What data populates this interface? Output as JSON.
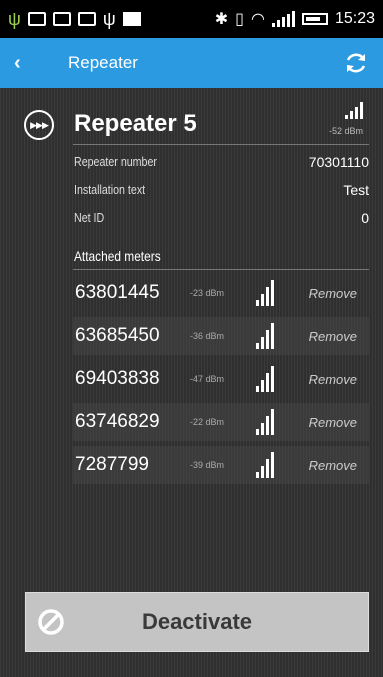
{
  "status_bar": {
    "time": "15:23",
    "icons": [
      "android-debug-icon",
      "notification-icon",
      "screenshot-icon",
      "photo-icon",
      "usb-icon",
      "storage-icon",
      "bluetooth-icon",
      "vibrate-icon",
      "wifi-icon",
      "cell-signal-icon",
      "battery-icon"
    ]
  },
  "action_bar": {
    "title": "Repeater",
    "back_icon": "chevron-left-icon",
    "refresh_icon": "refresh-icon",
    "color": "#2b9ae0"
  },
  "repeater": {
    "title": "Repeater 5",
    "signal_dbm": "-52 dBm",
    "signal_level": 4,
    "fields": [
      {
        "label": "Repeater number",
        "value": "70301110"
      },
      {
        "label": "Installation text",
        "value": "Test"
      },
      {
        "label": "Net ID",
        "value": "0"
      }
    ]
  },
  "meters_section": {
    "label": "Attached meters",
    "remove_label": "Remove",
    "meters": [
      {
        "number": "63801445",
        "dbm": "-23 dBm",
        "signal_level": 4
      },
      {
        "number": "63685450",
        "dbm": "-36 dBm",
        "signal_level": 4
      },
      {
        "number": "69403838",
        "dbm": "-47 dBm",
        "signal_level": 4
      },
      {
        "number": "63746829",
        "dbm": "-22 dBm",
        "signal_level": 4
      },
      {
        "number": "7287799",
        "dbm": "-39 dBm",
        "signal_level": 4
      }
    ]
  },
  "deactivate_button": {
    "label": "Deactivate",
    "icon": "block-icon"
  }
}
